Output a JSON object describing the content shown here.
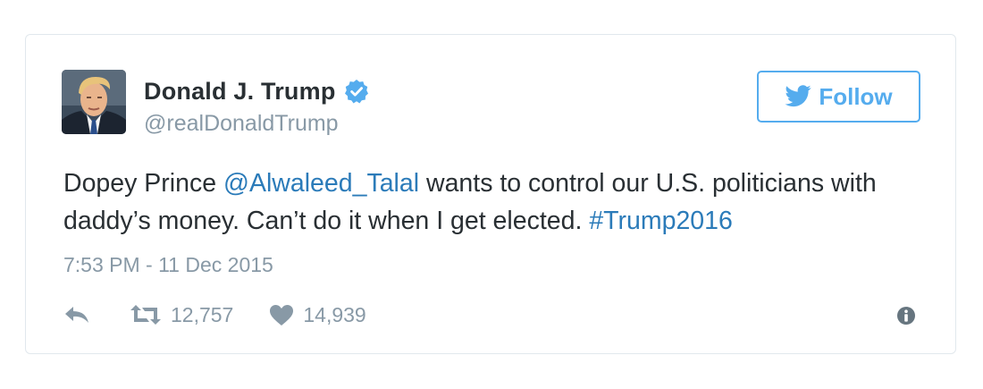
{
  "tweet": {
    "author": {
      "display_name": "Donald J. Trump",
      "handle": "@realDonaldTrump",
      "verified_icon": "verified-badge-icon",
      "avatar_icon": "profile-photo"
    },
    "follow_button": {
      "label": "Follow",
      "icon": "twitter-bird-icon"
    },
    "text": {
      "part1": "Dopey Prince ",
      "mention": "@Alwaleed_Talal",
      "part2": " wants to control our U.S. politicians with daddy’s money. Can’t do it when I get elected. ",
      "hashtag": "#Trump2016"
    },
    "timestamp": "7:53 PM - 11 Dec 2015",
    "actions": {
      "reply_icon": "reply-icon",
      "retweet_icon": "retweet-icon",
      "retweet_count": "12,757",
      "like_icon": "heart-icon",
      "like_count": "14,939",
      "info_icon": "info-icon"
    }
  },
  "colors": {
    "link": "#2b7bb9",
    "accent": "#55acee",
    "text": "#292f33",
    "muted": "#8899a6",
    "border": "#e1e8ed"
  }
}
